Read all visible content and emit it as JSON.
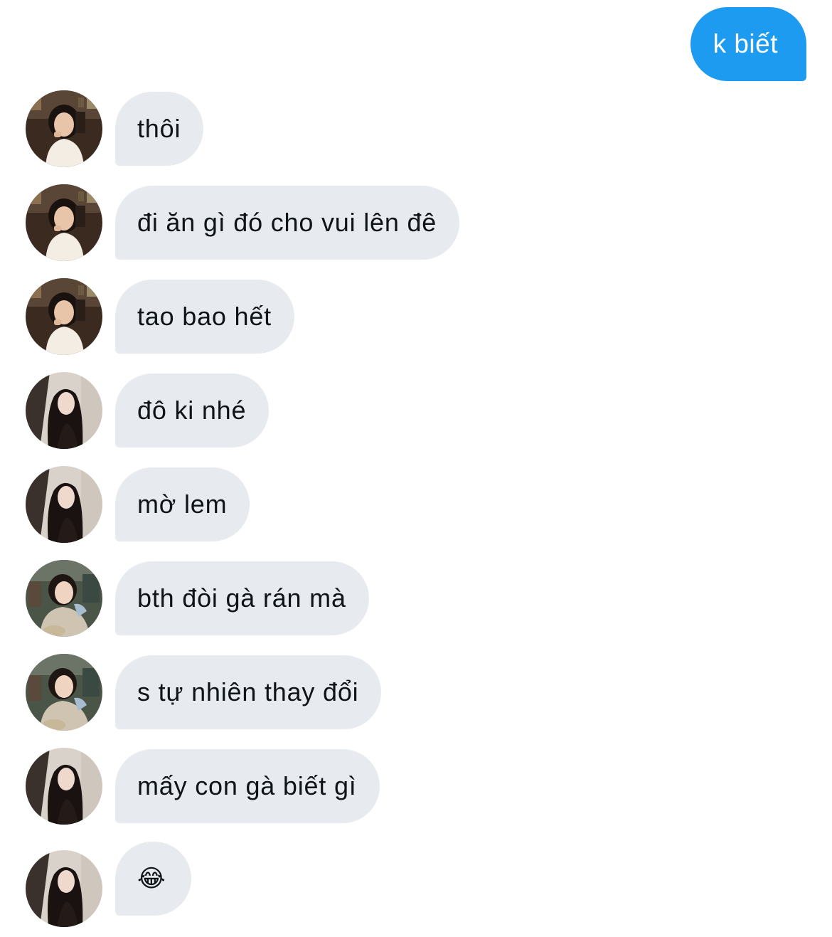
{
  "conversation": {
    "sent_message": "k biết",
    "messages": [
      {
        "text": "thôi",
        "sender": "user-a"
      },
      {
        "text": "đi ăn gì đó cho vui lên đê",
        "sender": "user-a"
      },
      {
        "text": "tao bao hết",
        "sender": "user-a"
      },
      {
        "text": "đô ki nhé",
        "sender": "user-b"
      },
      {
        "text": "mờ lem",
        "sender": "user-b"
      },
      {
        "text": "bth đòi gà rán mà",
        "sender": "user-c"
      },
      {
        "text": "s tự nhiên thay đổi",
        "sender": "user-c"
      },
      {
        "text": "mấy con gà biết gì",
        "sender": "user-b"
      },
      {
        "text": "😂",
        "sender": "user-b"
      }
    ]
  },
  "colors": {
    "sent_bubble": "#1d9bf0",
    "received_bubble": "#e7ebef",
    "received_text": "#0f1419",
    "sent_text": "#ffffff"
  },
  "icons": {
    "avatar_a": "avatar-woman-white-top-icon",
    "avatar_b": "avatar-woman-long-hair-icon",
    "avatar_c": "avatar-woman-sweater-icon"
  }
}
